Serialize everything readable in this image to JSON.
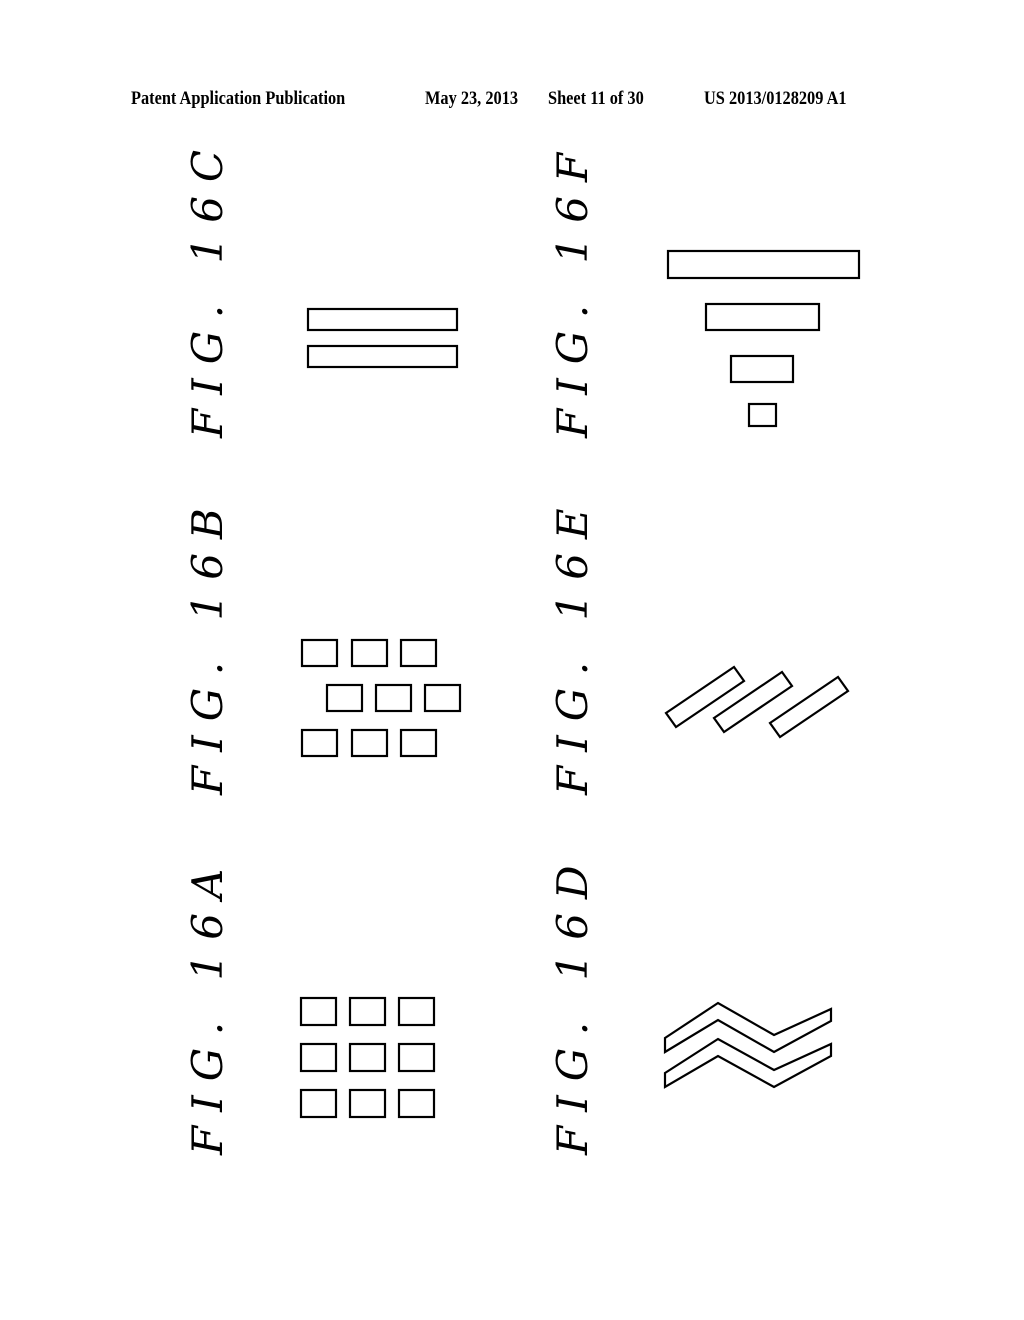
{
  "header": {
    "publication": "Patent Application Publication",
    "date": "May 23, 2013",
    "sheet": "Sheet 11 of 30",
    "patent_number": "US 2013/0128209 A1"
  },
  "figures": {
    "fig16a": {
      "label": "FIG. 16A",
      "description": "3x3 grid of squares"
    },
    "fig16b": {
      "label": "FIG. 16B",
      "description": "3 rows of 3 squares, middle row offset (brick pattern)"
    },
    "fig16c": {
      "label": "FIG. 16C",
      "description": "2 long parallel rectangles"
    },
    "fig16d": {
      "label": "FIG. 16D",
      "description": "2 parallel chevron/zigzag strips"
    },
    "fig16e": {
      "label": "FIG. 16E",
      "description": "3 diagonal rectangles"
    },
    "fig16f": {
      "label": "FIG. 16F",
      "description": "4 stacked rectangles decreasing in width"
    }
  }
}
